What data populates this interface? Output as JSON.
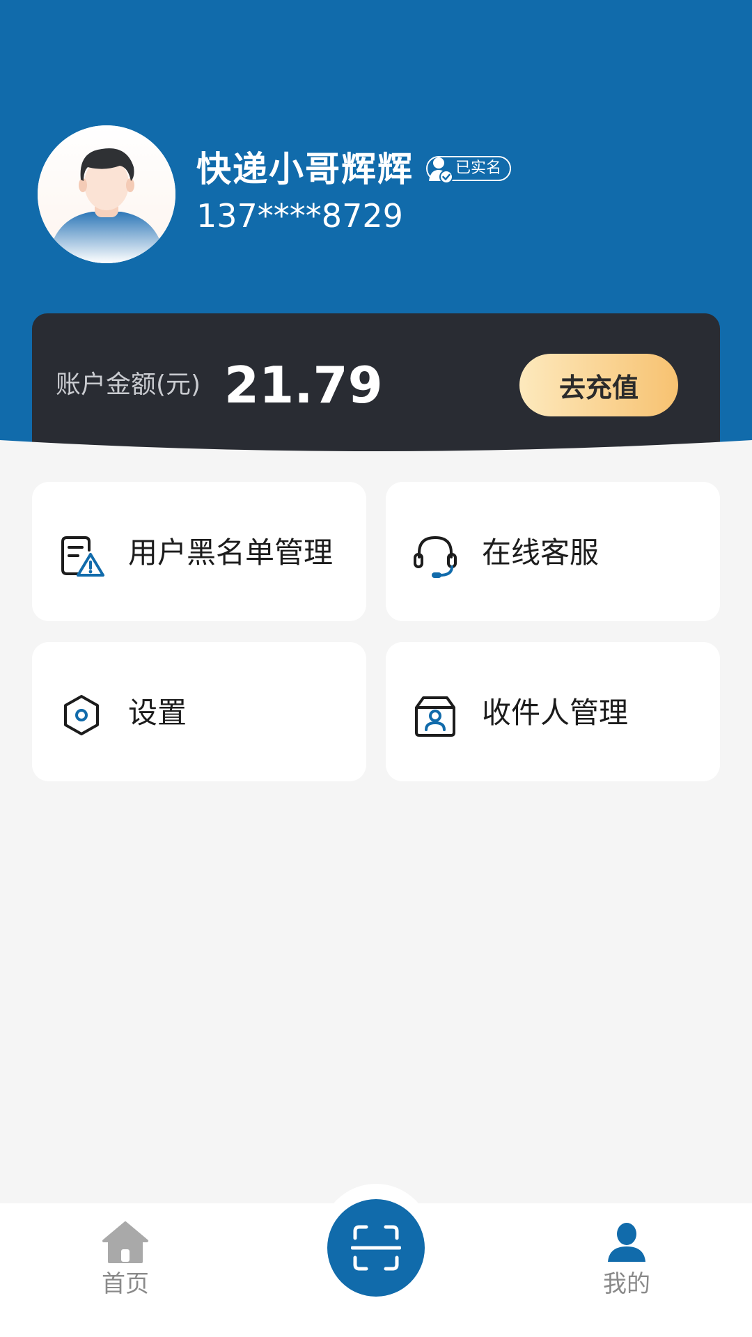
{
  "profile": {
    "name": "快递小哥辉辉",
    "verified_label": "已实名",
    "phone": "137****8729"
  },
  "balance": {
    "label": "账户金额(元)",
    "amount": "21.79",
    "recharge_label": "去充值"
  },
  "menu": {
    "items": [
      {
        "label": "用户黑名单管理",
        "icon": "blacklist-icon"
      },
      {
        "label": "在线客服",
        "icon": "headset-icon"
      },
      {
        "label": "设置",
        "icon": "settings-hexagon-icon"
      },
      {
        "label": "收件人管理",
        "icon": "recipient-box-icon"
      }
    ]
  },
  "tabbar": {
    "home_label": "首页",
    "mine_label": "我的",
    "scan_icon": "scan-icon"
  },
  "colors": {
    "header_blue": "#116bab",
    "card_dark": "#292c33",
    "recharge_gradient_start": "#fde9bd",
    "recharge_gradient_end": "#f7c271",
    "page_bg": "#f5f5f5"
  }
}
